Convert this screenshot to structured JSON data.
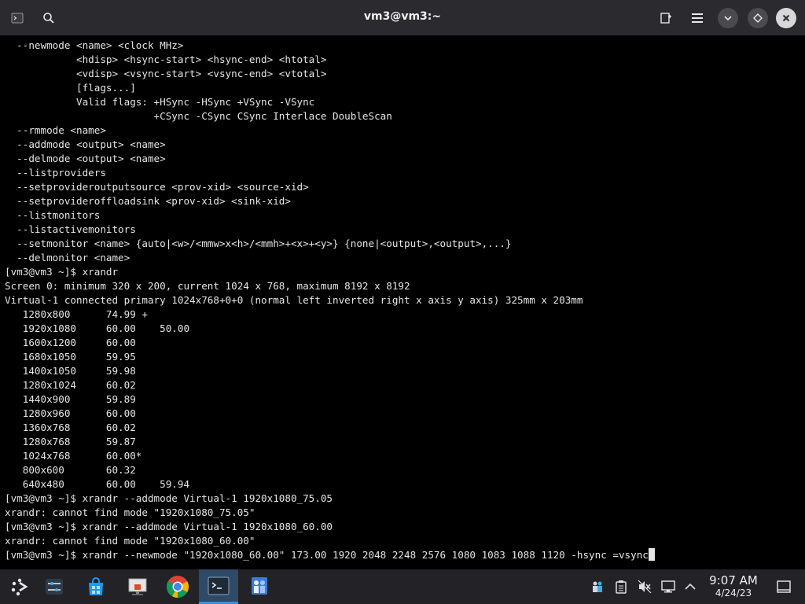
{
  "window": {
    "title": "vm3@vm3:~",
    "icons": [
      "terminal-app-icon",
      "search-icon",
      "new-tab-icon",
      "hamburger-menu-icon",
      "minimize-icon",
      "maximize-icon",
      "close-icon"
    ]
  },
  "terminal": {
    "lines": [
      "  --newmode <name> <clock MHz>",
      "            <hdisp> <hsync-start> <hsync-end> <htotal>",
      "            <vdisp> <vsync-start> <vsync-end> <vtotal>",
      "            [flags...]",
      "            Valid flags: +HSync -HSync +VSync -VSync",
      "                         +CSync -CSync CSync Interlace DoubleScan",
      "  --rmmode <name>",
      "  --addmode <output> <name>",
      "  --delmode <output> <name>",
      "  --listproviders",
      "  --setprovideroutputsource <prov-xid> <source-xid>",
      "  --setprovideroffloadsink <prov-xid> <sink-xid>",
      "  --listmonitors",
      "  --listactivemonitors",
      "  --setmonitor <name> {auto|<w>/<mmw>x<h>/<mmh>+<x>+<y>} {none|<output>,<output>,...}",
      "  --delmonitor <name>",
      "[vm3@vm3 ~]$ xrandr",
      "Screen 0: minimum 320 x 200, current 1024 x 768, maximum 8192 x 8192",
      "Virtual-1 connected primary 1024x768+0+0 (normal left inverted right x axis y axis) 325mm x 203mm",
      "   1280x800      74.99 +",
      "   1920x1080     60.00    50.00",
      "   1600x1200     60.00",
      "   1680x1050     59.95",
      "   1400x1050     59.98",
      "   1280x1024     60.02",
      "   1440x900      59.89",
      "   1280x960      60.00",
      "   1360x768      60.02",
      "   1280x768      59.87",
      "   1024x768      60.00*",
      "   800x600       60.32",
      "   640x480       60.00    59.94",
      "[vm3@vm3 ~]$ xrandr --addmode Virtual-1 1920x1080_75.05",
      "xrandr: cannot find mode \"1920x1080_75.05\"",
      "[vm3@vm3 ~]$ xrandr --addmode Virtual-1 1920x1080_60.00",
      "xrandr: cannot find mode \"1920x1080_60.00\""
    ],
    "prompt_line": "[vm3@vm3 ~]$ xrandr --newmode \"1920x1080_60.00\" 173.00 1920 2048 2248 2576 1080 1083 1088 1120 -hsync =vsync"
  },
  "taskbar": {
    "items": [
      {
        "name": "app-launcher-icon"
      },
      {
        "name": "system-settings-icon"
      },
      {
        "name": "software-store-icon"
      },
      {
        "name": "file-manager-icon"
      },
      {
        "name": "chrome-icon"
      },
      {
        "name": "terminal-icon",
        "active": true
      },
      {
        "name": "remote-desktop-icon"
      }
    ],
    "tray": [
      "network-app-icon",
      "clipboard-icon",
      "volume-muted-icon",
      "display-icon",
      "tray-expand-icon"
    ],
    "clock": {
      "time": "9:07 AM",
      "date": "4/24/23"
    }
  },
  "colors": {
    "titlebar": "#2b2b2f",
    "terminal_bg": "#000000",
    "terminal_fg": "#e6e6e6",
    "taskbar": "#232327",
    "active_task": "#2e4a66"
  }
}
